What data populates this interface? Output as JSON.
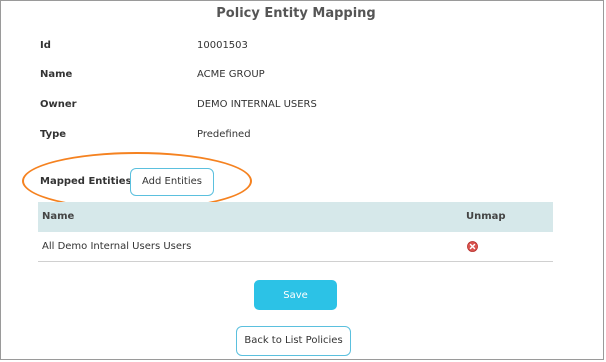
{
  "page": {
    "title": "Policy Entity Mapping"
  },
  "fields": [
    {
      "label": "Id",
      "value": "10001503"
    },
    {
      "label": "Name",
      "value": "ACME GROUP"
    },
    {
      "label": "Owner",
      "value": "DEMO INTERNAL USERS"
    },
    {
      "label": "Type",
      "value": "Predefined"
    }
  ],
  "mapped": {
    "label": "Mapped Entities :",
    "add_button": "Add Entities"
  },
  "table": {
    "headers": [
      "Name",
      "Unmap"
    ],
    "rows": [
      {
        "name": "All Demo Internal Users Users",
        "unmap_icon": "remove-circle-icon"
      }
    ]
  },
  "actions": {
    "save": "Save",
    "back": "Back to List Policies"
  },
  "colors": {
    "accent": "#2cc2e6",
    "button_border": "#5bc0de",
    "table_header_bg": "#d6e8ea",
    "highlight": "#f58220",
    "remove_icon": "#d9534f"
  }
}
